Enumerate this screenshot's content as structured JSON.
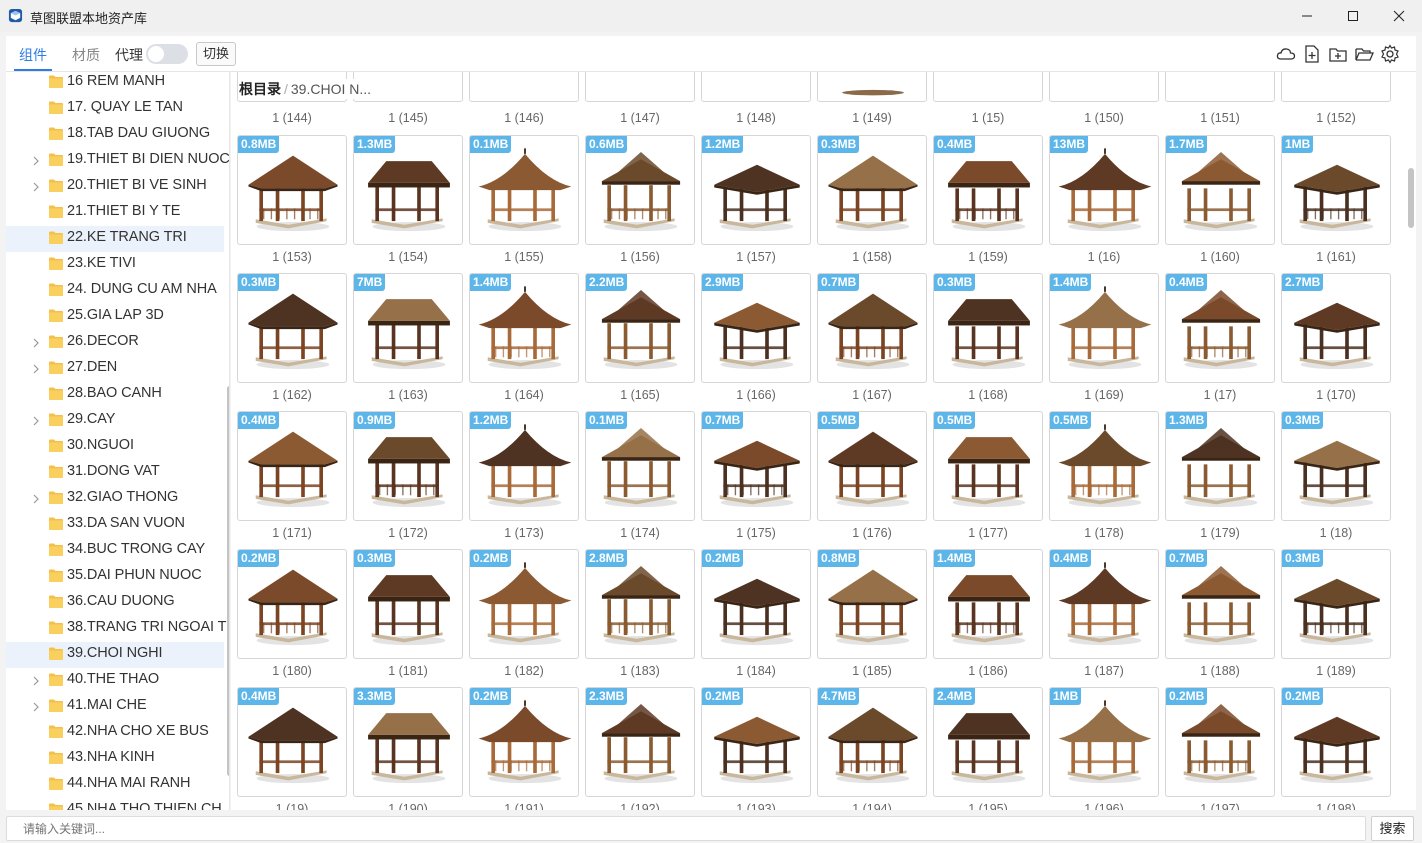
{
  "window": {
    "title": "草图联盟本地资产库",
    "icon": "cube-app-icon"
  },
  "toolbar": {
    "tab_components": "组件",
    "tab_materials": "材质",
    "proxy_label": "代理",
    "proxy_enabled": false,
    "switch_label": "切换",
    "icons": [
      "cloud-icon",
      "new-file-icon",
      "new-folder-icon",
      "open-folder-icon",
      "gear-icon"
    ]
  },
  "sidebar": {
    "items": [
      {
        "label": "16 REM MANH",
        "expandable": false,
        "selected": false
      },
      {
        "label": "17. QUAY LE TAN",
        "expandable": false,
        "selected": false
      },
      {
        "label": "18.TAB DAU GIUONG",
        "expandable": false,
        "selected": false
      },
      {
        "label": "19.THIET BI DIEN NUOC",
        "expandable": true,
        "selected": false
      },
      {
        "label": "20.THIET BI VE SINH",
        "expandable": true,
        "selected": false
      },
      {
        "label": "21.THIET BI Y TE",
        "expandable": false,
        "selected": false
      },
      {
        "label": "22.KE TRANG TRI",
        "expandable": false,
        "selected": true
      },
      {
        "label": "23.KE TIVI",
        "expandable": false,
        "selected": false
      },
      {
        "label": "24. DUNG CU AM NHA",
        "expandable": false,
        "selected": false
      },
      {
        "label": "25.GIA LAP 3D",
        "expandable": false,
        "selected": false
      },
      {
        "label": "26.DECOR",
        "expandable": true,
        "selected": false
      },
      {
        "label": "27.DEN",
        "expandable": true,
        "selected": false
      },
      {
        "label": "28.BAO CANH",
        "expandable": false,
        "selected": false
      },
      {
        "label": "29.CAY",
        "expandable": true,
        "selected": false
      },
      {
        "label": "30.NGUOI",
        "expandable": false,
        "selected": false
      },
      {
        "label": "31.DONG VAT",
        "expandable": false,
        "selected": false
      },
      {
        "label": "32.GIAO THONG",
        "expandable": true,
        "selected": false
      },
      {
        "label": "33.DA SAN VUON",
        "expandable": false,
        "selected": false
      },
      {
        "label": "34.BUC TRONG CAY",
        "expandable": false,
        "selected": false
      },
      {
        "label": "35.DAI PHUN NUOC",
        "expandable": false,
        "selected": false
      },
      {
        "label": "36.CAU DUONG",
        "expandable": false,
        "selected": false
      },
      {
        "label": "38.TRANG TRI NGOAI T",
        "expandable": false,
        "selected": false
      },
      {
        "label": "39.CHOI NGHI",
        "expandable": false,
        "selected": true
      },
      {
        "label": "40.THE THAO",
        "expandable": true,
        "selected": false
      },
      {
        "label": "41.MAI CHE",
        "expandable": true,
        "selected": false
      },
      {
        "label": "42.NHA CHO XE BUS",
        "expandable": false,
        "selected": false
      },
      {
        "label": "43.NHA KINH",
        "expandable": false,
        "selected": false
      },
      {
        "label": "44.NHA MAI RANH",
        "expandable": false,
        "selected": false
      },
      {
        "label": "45.NHA THO THIEN CH",
        "expandable": false,
        "selected": false
      }
    ]
  },
  "breadcrumb": {
    "root": "根目录",
    "separator": "/",
    "current": "39.CHOI N..."
  },
  "top_captions": [
    "1 (144)",
    "1 (145)",
    "1 (146)",
    "1 (147)",
    "1 (148)",
    "1 (149)",
    "1 (15)",
    "1 (150)",
    "1 (151)",
    "1 (152)"
  ],
  "rows": [
    [
      {
        "size": "0.8MB",
        "caption": "1 (153)"
      },
      {
        "size": "1.3MB",
        "caption": "1 (154)"
      },
      {
        "size": "0.1MB",
        "caption": "1 (155)"
      },
      {
        "size": "0.6MB",
        "caption": "1 (156)"
      },
      {
        "size": "1.2MB",
        "caption": "1 (157)"
      },
      {
        "size": "0.3MB",
        "caption": "1 (158)"
      },
      {
        "size": "0.4MB",
        "caption": "1 (159)"
      },
      {
        "size": "13MB",
        "caption": "1 (16)"
      },
      {
        "size": "1.7MB",
        "caption": "1 (160)"
      },
      {
        "size": "1MB",
        "caption": "1 (161)"
      }
    ],
    [
      {
        "size": "0.3MB",
        "caption": "1 (162)"
      },
      {
        "size": "7MB",
        "caption": "1 (163)"
      },
      {
        "size": "1.4MB",
        "caption": "1 (164)"
      },
      {
        "size": "2.2MB",
        "caption": "1 (165)"
      },
      {
        "size": "2.9MB",
        "caption": "1 (166)"
      },
      {
        "size": "0.7MB",
        "caption": "1 (167)"
      },
      {
        "size": "0.3MB",
        "caption": "1 (168)"
      },
      {
        "size": "1.4MB",
        "caption": "1 (169)"
      },
      {
        "size": "0.4MB",
        "caption": "1 (17)"
      },
      {
        "size": "2.7MB",
        "caption": "1 (170)"
      }
    ],
    [
      {
        "size": "0.4MB",
        "caption": "1 (171)"
      },
      {
        "size": "0.9MB",
        "caption": "1 (172)"
      },
      {
        "size": "1.2MB",
        "caption": "1 (173)"
      },
      {
        "size": "0.1MB",
        "caption": "1 (174)"
      },
      {
        "size": "0.7MB",
        "caption": "1 (175)"
      },
      {
        "size": "0.5MB",
        "caption": "1 (176)"
      },
      {
        "size": "0.5MB",
        "caption": "1 (177)"
      },
      {
        "size": "0.5MB",
        "caption": "1 (178)"
      },
      {
        "size": "1.3MB",
        "caption": "1 (179)"
      },
      {
        "size": "0.3MB",
        "caption": "1 (18)"
      }
    ],
    [
      {
        "size": "0.2MB",
        "caption": "1 (180)"
      },
      {
        "size": "0.3MB",
        "caption": "1 (181)"
      },
      {
        "size": "0.2MB",
        "caption": "1 (182)"
      },
      {
        "size": "2.8MB",
        "caption": "1 (183)"
      },
      {
        "size": "0.2MB",
        "caption": "1 (184)"
      },
      {
        "size": "0.8MB",
        "caption": "1 (185)"
      },
      {
        "size": "1.4MB",
        "caption": "1 (186)"
      },
      {
        "size": "0.4MB",
        "caption": "1 (187)"
      },
      {
        "size": "0.7MB",
        "caption": "1 (188)"
      },
      {
        "size": "0.3MB",
        "caption": "1 (189)"
      }
    ],
    [
      {
        "size": "0.4MB",
        "caption": "1 (19)"
      },
      {
        "size": "3.3MB",
        "caption": "1 (190)"
      },
      {
        "size": "0.2MB",
        "caption": "1 (191)"
      },
      {
        "size": "2.3MB",
        "caption": "1 (192)"
      },
      {
        "size": "0.2MB",
        "caption": "1 (193)"
      },
      {
        "size": "4.7MB",
        "caption": "1 (194)"
      },
      {
        "size": "2.4MB",
        "caption": "1 (195)"
      },
      {
        "size": "1MB",
        "caption": "1 (196)"
      },
      {
        "size": "0.2MB",
        "caption": "1 (197)"
      },
      {
        "size": "0.2MB",
        "caption": "1 (198)"
      }
    ]
  ],
  "search": {
    "placeholder": "请输入关键词...",
    "button_label": "搜索"
  },
  "colors": {
    "accent": "#2f7de1",
    "badge": "#5db6ea",
    "folder": "#f5c04a",
    "wood_dark": "#6b3f22",
    "wood_mid": "#9a5b2e",
    "roof": "#7a4a2a"
  }
}
